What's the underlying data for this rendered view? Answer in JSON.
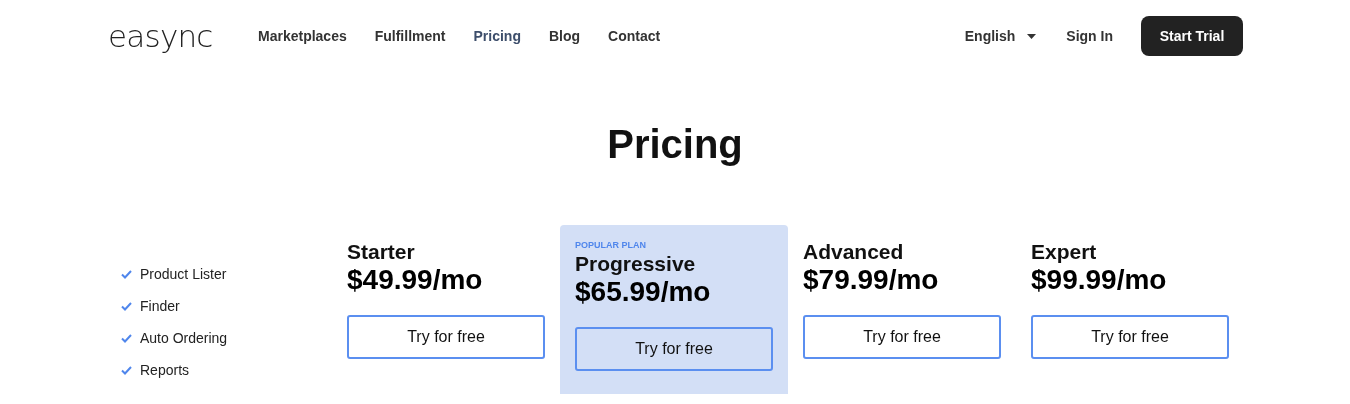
{
  "logo": "easync",
  "nav": [
    {
      "label": "Marketplaces",
      "selected": false
    },
    {
      "label": "Fulfillment",
      "selected": false
    },
    {
      "label": "Pricing",
      "selected": true
    },
    {
      "label": "Blog",
      "selected": false
    },
    {
      "label": "Contact",
      "selected": false
    }
  ],
  "language": "English",
  "sign_in": "Sign In",
  "cta": "Start Trial",
  "heading": "Pricing",
  "features": [
    "Product Lister",
    "Finder",
    "Auto Ordering",
    "Reports"
  ],
  "plans": [
    {
      "name": "Starter",
      "price": "$49.99/mo",
      "button": "Try for free",
      "popular": false
    },
    {
      "badge": "POPULAR PLAN",
      "name": "Progressive",
      "price": "$65.99/mo",
      "button": "Try for free",
      "popular": true
    },
    {
      "name": "Advanced",
      "price": "$79.99/mo",
      "button": "Try for free",
      "popular": false
    },
    {
      "name": "Expert",
      "price": "$99.99/mo",
      "button": "Try for free",
      "popular": false
    }
  ]
}
